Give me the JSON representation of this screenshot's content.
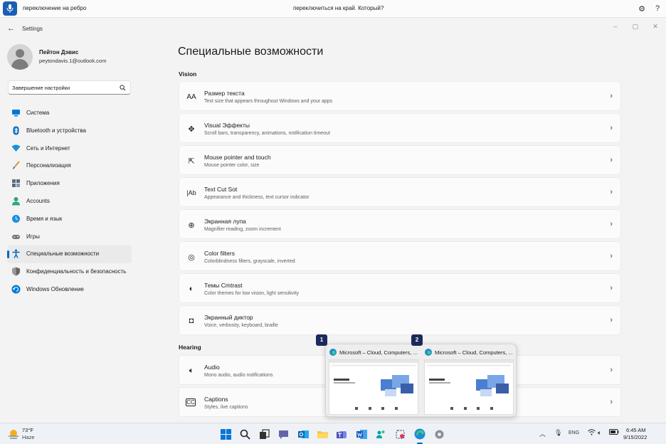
{
  "voice_bar": {
    "left_text": "переключение на ребро",
    "center_text": "переключиться на край. Который?"
  },
  "window": {
    "title": "Settings"
  },
  "user": {
    "name": "Пейтон Дэвис",
    "email": "peytondavis.1@outlook.com"
  },
  "search": {
    "value": "Завершение настройки"
  },
  "sidebar": {
    "items": [
      {
        "label": "Система",
        "icon": "system-display-icon",
        "color": "#0078d4"
      },
      {
        "label": "Bluetooth и устройства",
        "icon": "bluetooth-icon",
        "color": "#0067c0"
      },
      {
        "label": "Сеть и Интернет",
        "icon": "wifi-icon",
        "color": "#1c8fe0"
      },
      {
        "label": "Персонализация",
        "icon": "brush-icon",
        "color": "#e2902c"
      },
      {
        "label": "Приложения",
        "icon": "apps-icon",
        "color": "#5c6b7a"
      },
      {
        "label": "Accounts",
        "icon": "account-icon",
        "color": "#2aa876"
      },
      {
        "label": "Время и язык",
        "icon": "time-language-icon",
        "color": "#1c8fe0"
      },
      {
        "label": "Игры",
        "icon": "gaming-icon",
        "color": "#777"
      },
      {
        "label": "Специальные возможности",
        "icon": "accessibility-icon",
        "color": "#0067c0",
        "active": true
      },
      {
        "label": "Конфиденциальность и безопасность",
        "icon": "shield-icon",
        "color": "#666"
      },
      {
        "label": "Windows Обновление",
        "icon": "update-icon",
        "color": "#0078d4"
      }
    ]
  },
  "main": {
    "title": "Специальные возможности",
    "vision_header": "Vision",
    "hearing_header": "Hearing",
    "vision_cards": [
      {
        "icon": "text-size-icon",
        "title": "Размер текста",
        "subtitle": "Text size that appears throughout Windows and your apps"
      },
      {
        "icon": "visual-effects-icon",
        "title": "Visual Эффекты",
        "subtitle": "Scroll bars, transparency, animations, notification timeout"
      },
      {
        "icon": "mouse-pointer-icon",
        "title": "Mouse pointer and touch",
        "subtitle": "Mouse pointer color, size"
      },
      {
        "icon": "text-cursor-icon",
        "title": "Text Cut Sot",
        "subtitle": "Appearance and thickness, text cursor indicator"
      },
      {
        "icon": "magnifier-icon",
        "title": "Экранная лупа",
        "subtitle": "Magnifier reading, zoom increment"
      },
      {
        "icon": "color-filters-icon",
        "title": "Color filters",
        "subtitle": "Colorblindness filters, grayscale, inverted"
      },
      {
        "icon": "contrast-themes-icon",
        "title": "Темы Cmtrast",
        "subtitle": "Color themes for low vision, light sensitivity"
      },
      {
        "icon": "narrator-icon",
        "title": "Экранный диктор",
        "subtitle": "Voice, verbosity, keyboard, braille"
      }
    ],
    "hearing_cards": [
      {
        "icon": "audio-icon",
        "title": "Audio",
        "subtitle": "Mono audio, audio notifications"
      },
      {
        "icon": "captions-icon",
        "title": "Captions",
        "subtitle": "Styles, live captions"
      }
    ]
  },
  "preview": {
    "windows": [
      {
        "badge": "1",
        "title": "Microsoft – Cloud, Computers, ..."
      },
      {
        "badge": "2",
        "title": "Microsoft – Cloud, Computers, ..."
      }
    ]
  },
  "taskbar": {
    "weather_temp": "73°F",
    "weather_cond": "Haze",
    "lang": "ENG",
    "time": "6:45 AM",
    "date": "9/15/2022"
  }
}
